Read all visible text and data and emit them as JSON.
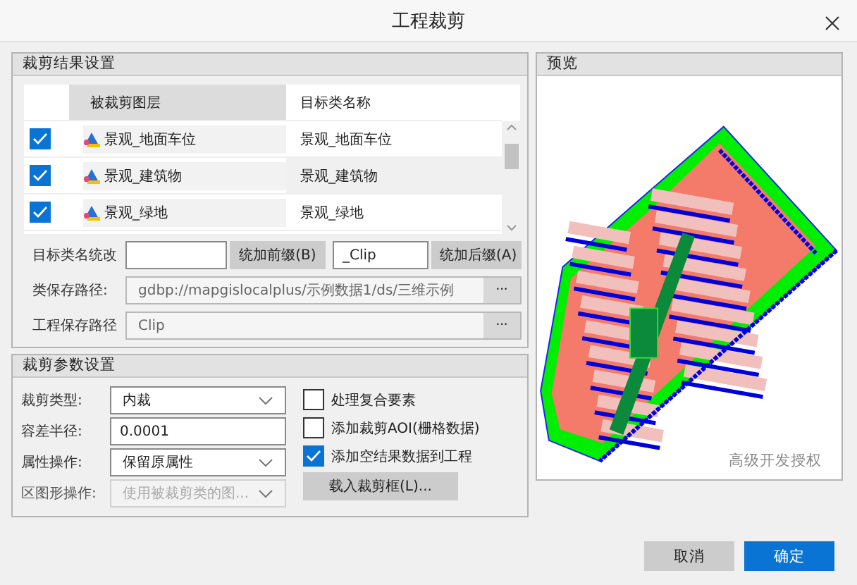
{
  "window": {
    "title": "工程裁剪"
  },
  "result_settings": {
    "title": "裁剪结果设置",
    "columns": [
      "被裁剪图层",
      "目标类名称"
    ],
    "rows": [
      {
        "layer": "景观_地面车位",
        "target": "景观_地面车位",
        "checked": true
      },
      {
        "layer": "景观_建筑物",
        "target": "景观_建筑物",
        "checked": true
      },
      {
        "layer": "景观_绿地",
        "target": "景观_绿地",
        "checked": true
      }
    ],
    "rename": {
      "label": "目标类名统改",
      "prefix_button": "统加前缀(B)",
      "suffix_value": "_Clip",
      "suffix_button": "统加后缀(A)"
    },
    "paths": [
      {
        "label": "类保存路径:",
        "value": "gdbp://mapgislocalplus/示例数据1/ds/三维示例",
        "button": "···"
      },
      {
        "label": "工程保存路径",
        "value": "Clip",
        "button": "···"
      }
    ]
  },
  "clip_params": {
    "title": "裁剪参数设置",
    "fields": [
      {
        "kind": "dropdown",
        "label": "裁剪类型:",
        "value": "内裁",
        "disabled": false
      },
      {
        "kind": "input",
        "label": "容差半径:",
        "value": "0.0001",
        "disabled": false
      },
      {
        "kind": "dropdown",
        "label": "属性操作:",
        "value": "保留原属性",
        "disabled": false
      },
      {
        "kind": "dropdown",
        "label": "区图形操作:",
        "value": "使用被裁剪类的图...",
        "disabled": true
      }
    ],
    "options": [
      {
        "label": "处理复合要素",
        "checked": false
      },
      {
        "label": "添加裁剪AOI(栅格数据)",
        "checked": false
      },
      {
        "label": "添加空结果数据到工程",
        "checked": true
      }
    ],
    "load_button": "载入裁剪框(L)..."
  },
  "preview": {
    "title": "预览",
    "license_note": "高级开发授权"
  },
  "buttons": [
    {
      "label": "取消",
      "primary": false
    },
    {
      "label": "确定",
      "primary": true
    }
  ]
}
